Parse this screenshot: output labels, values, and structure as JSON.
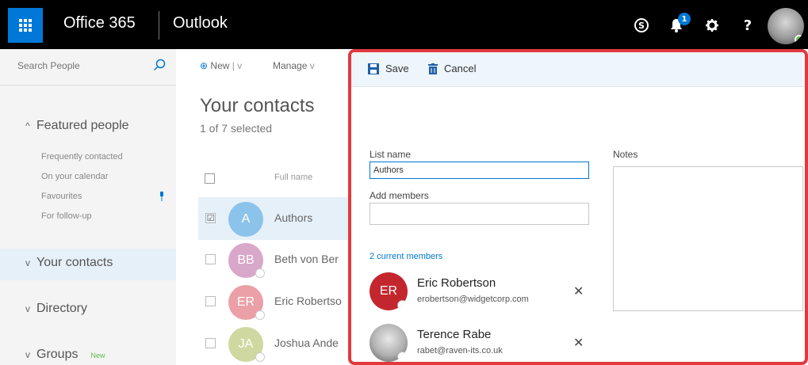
{
  "header": {
    "brand": "Office 365",
    "app": "Outlook",
    "notification_count": "1",
    "help": "?"
  },
  "sidebar": {
    "search_placeholder": "Search People",
    "featured_label": "Featured people",
    "featured_items": [
      "Frequently contacted",
      "On your calendar",
      "Favourites",
      "For follow-up"
    ],
    "your_contacts_label": "Your contacts",
    "directory_label": "Directory",
    "groups_label": "Groups",
    "groups_tag": "New"
  },
  "main": {
    "new_label": "New",
    "manage_label": "Manage",
    "title": "Your contacts",
    "subtitle": "1 of 7 selected",
    "column_header": "Full name",
    "rows": [
      {
        "initials": "A",
        "name": "Authors",
        "color": "#8cc3ea",
        "checked": "☑"
      },
      {
        "initials": "BB",
        "name": "Beth von Ber",
        "color": "#d9a7c9",
        "checked": ""
      },
      {
        "initials": "ER",
        "name": "Eric Robertso",
        "color": "#eba0a8",
        "checked": ""
      },
      {
        "initials": "JA",
        "name": "Joshua Ande",
        "color": "#cfd8a0",
        "checked": ""
      }
    ]
  },
  "panel": {
    "save_label": "Save",
    "cancel_label": "Cancel",
    "list_name_label": "List name",
    "list_name_value": "Authors",
    "add_members_label": "Add members",
    "notes_label": "Notes",
    "members_link": "2 current members",
    "members": [
      {
        "initials": "ER",
        "name": "Eric Robertson",
        "email": "erobertson@widgetcorp.com",
        "color": "#c4262e"
      },
      {
        "initials": "",
        "name": "Terence Rabe",
        "email": "rabet@raven-its.co.uk",
        "color": "#8a8a8a"
      }
    ]
  },
  "colors": {
    "accent": "#0078d7",
    "highlight_border": "#e0393e",
    "topbar": "#000000"
  }
}
